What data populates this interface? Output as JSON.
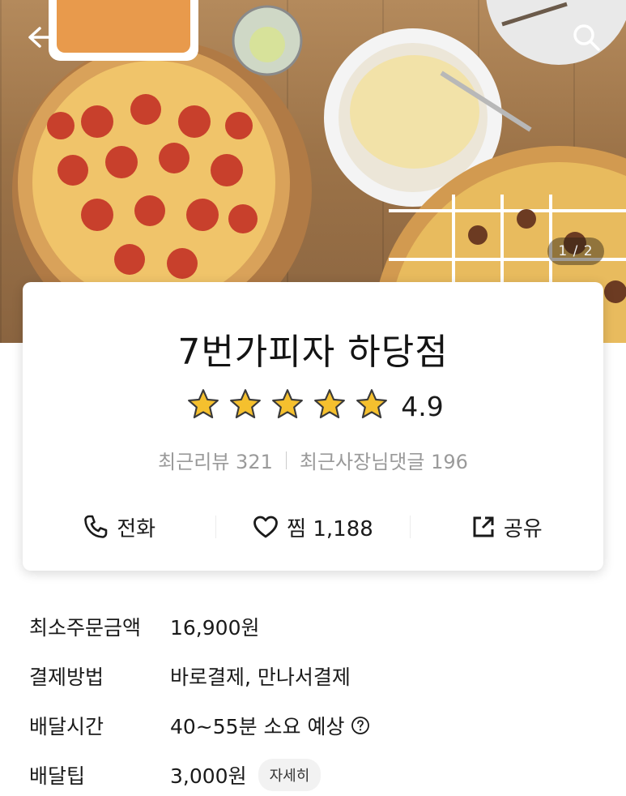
{
  "hero": {
    "image_counter": "1 / 2",
    "icons": {
      "back": "arrow-left-icon",
      "search": "search-icon"
    }
  },
  "store": {
    "name": "7번가피자 하당점",
    "rating": 4.9,
    "rating_text": "4.9",
    "stars_filled": 5,
    "recent_reviews_label": "최근리뷰 321",
    "recent_owner_replies_label": "최근사장님댓글 196"
  },
  "actions": {
    "call": {
      "label": "전화",
      "icon": "phone-icon"
    },
    "favorite": {
      "label": "찜 1,188",
      "icon": "heart-icon"
    },
    "share": {
      "label": "공유",
      "icon": "share-icon"
    }
  },
  "info": {
    "min_order": {
      "label": "최소주문금액",
      "value": "16,900원"
    },
    "payment": {
      "label": "결제방법",
      "value": "바로결제, 만나서결제"
    },
    "delivery_time": {
      "label": "배달시간",
      "value": "40~55분 소요 예상",
      "icon": "help-circle-icon"
    },
    "delivery_tip": {
      "label": "배달팁",
      "value": "3,000원",
      "detail_button": "자세히"
    }
  },
  "colors": {
    "star": "#f5c02e",
    "star_outline": "#3a3a3a",
    "hero_wood": "#9c7348",
    "secondary_text": "#9a9a9a"
  }
}
